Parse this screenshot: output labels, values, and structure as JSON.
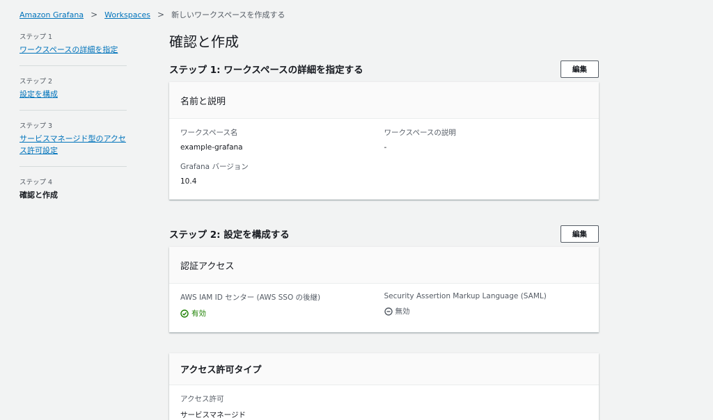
{
  "breadcrumb": {
    "root": "Amazon Grafana",
    "workspaces": "Workspaces",
    "current": "新しいワークスペースを作成する"
  },
  "sidebar": {
    "steps": [
      {
        "num": "ステップ 1",
        "label": "ワークスペースの詳細を指定"
      },
      {
        "num": "ステップ 2",
        "label": "設定を構成"
      },
      {
        "num": "ステップ 3",
        "label": "サービスマネージド型のアクセス許可設定"
      },
      {
        "num": "ステップ 4",
        "label": "確認と作成"
      }
    ]
  },
  "main": {
    "title": "確認と作成",
    "edit_label": "編集",
    "section1": {
      "title": "ステップ 1: ワークスペースの詳細を指定する",
      "card_title": "名前と説明",
      "name_label": "ワークスペース名",
      "name_value": "example-grafana",
      "desc_label": "ワークスペースの説明",
      "desc_value": "-",
      "version_label": "Grafana バージョン",
      "version_value": "10.4"
    },
    "section2": {
      "title": "ステップ 2: 設定を構成する",
      "card_title": "認証アクセス",
      "iam_label": "AWS IAM ID センター (AWS SSO の後継)",
      "iam_value": "有効",
      "saml_label": "Security Assertion Markup Language (SAML)",
      "saml_value": "無効"
    },
    "section3": {
      "card_title": "アクセス許可タイプ",
      "perm_label": "アクセス許可",
      "perm_value": "サービスマネージド"
    }
  },
  "colors": {
    "link": "#0073bb",
    "enabled": "#1d8102",
    "disabled": "#545b64",
    "background": "#f2f3f3"
  }
}
